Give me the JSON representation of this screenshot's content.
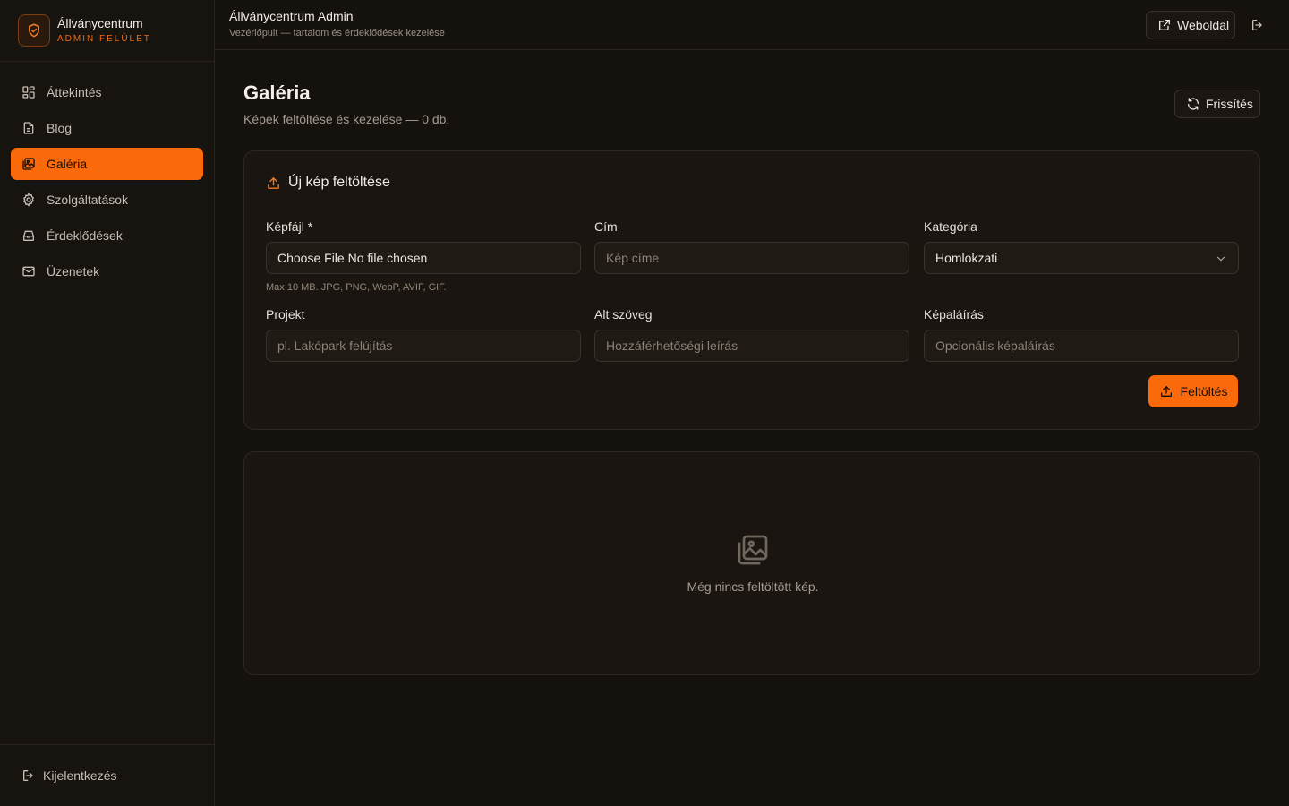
{
  "brand": {
    "name": "Állványcentrum",
    "subtitle": "ADMIN FELÜLET",
    "logo_icon": "shield-check-icon",
    "accent": "#fb6a0a"
  },
  "sidebar": {
    "items": [
      {
        "label": "Áttekintés",
        "icon": "dashboard-icon",
        "active": false
      },
      {
        "label": "Blog",
        "icon": "document-icon",
        "active": false
      },
      {
        "label": "Galéria",
        "icon": "gallery-icon",
        "active": true
      },
      {
        "label": "Szolgáltatások",
        "icon": "gear-icon",
        "active": false
      },
      {
        "label": "Érdeklődések",
        "icon": "inbox-icon",
        "active": false
      },
      {
        "label": "Üzenetek",
        "icon": "mail-icon",
        "active": false
      }
    ],
    "logout_label": "Kijelentkezés"
  },
  "topbar": {
    "title": "Állványcentrum Admin",
    "subtitle": "Vezérlőpult — tartalom és érdeklődések kezelése",
    "website_label": "Weboldal"
  },
  "page": {
    "title": "Galéria",
    "subtitle": "Képek feltöltése és kezelése — 0 db.",
    "refresh_label": "Frissítés"
  },
  "upload": {
    "title": "Új kép feltöltése",
    "file_label": "Képfájl *",
    "file_value": "Choose File No file chosen",
    "file_hint": "Max 10 MB. JPG, PNG, WebP, AVIF, GIF.",
    "title_label": "Cím",
    "title_placeholder": "Kép címe",
    "category_label": "Kategória",
    "category_value": "Homlokzati",
    "project_label": "Projekt",
    "project_placeholder": "pl. Lakópark felújítás",
    "alt_label": "Alt szöveg",
    "alt_placeholder": "Hozzáférhetőségi leírás",
    "caption_label": "Képaláírás",
    "caption_placeholder": "Opcionális képaláírás",
    "submit_label": "Feltöltés"
  },
  "gallery": {
    "empty_text": "Még nincs feltöltött kép."
  }
}
